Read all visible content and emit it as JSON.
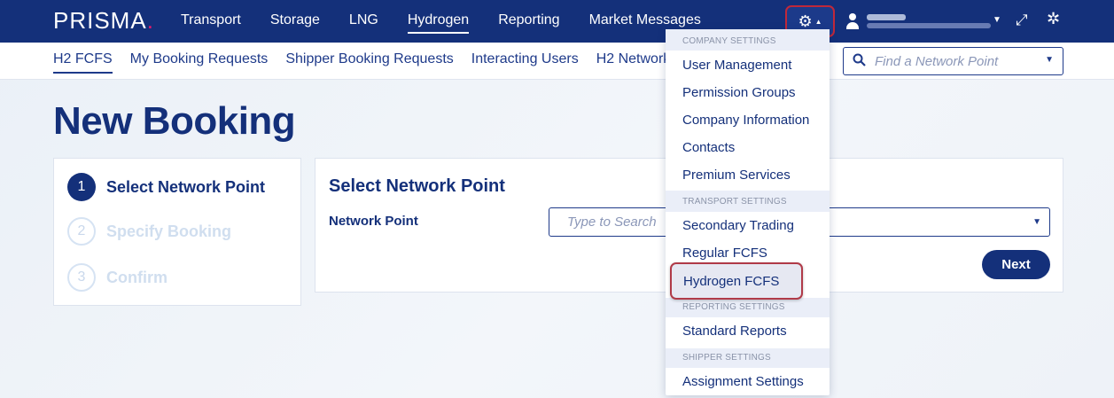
{
  "brand": {
    "name": "PRISMA",
    "dot": ".",
    "accent": "#e6196a",
    "primary": "#14307a"
  },
  "main_nav": [
    {
      "label": "Transport",
      "active": false
    },
    {
      "label": "Storage",
      "active": false
    },
    {
      "label": "LNG",
      "active": false
    },
    {
      "label": "Hydrogen",
      "active": true
    },
    {
      "label": "Reporting",
      "active": false
    },
    {
      "label": "Market Messages",
      "active": false
    }
  ],
  "header_icons": {
    "settings": "gear-icon",
    "user": "user-icon",
    "expand": "expand-icon",
    "bug": "bug-icon"
  },
  "sub_nav": [
    {
      "label": "H2 FCFS",
      "active": true
    },
    {
      "label": "My Booking Requests",
      "active": false
    },
    {
      "label": "Shipper Booking Requests",
      "active": false
    },
    {
      "label": "Interacting Users",
      "active": false
    },
    {
      "label": "H2 Network",
      "active": false
    }
  ],
  "network_search": {
    "placeholder": "Find a Network Point"
  },
  "page": {
    "title": "New Booking"
  },
  "steps": [
    {
      "num": "1",
      "label": "Select Network Point",
      "state": "active"
    },
    {
      "num": "2",
      "label": "Specify Booking",
      "state": "inactive"
    },
    {
      "num": "3",
      "label": "Confirm",
      "state": "inactive"
    }
  ],
  "form": {
    "title": "Select Network Point",
    "field_label": "Network Point",
    "placeholder": "Type to Search",
    "next_label": "Next"
  },
  "settings_menu": {
    "sections": [
      {
        "title": "COMPANY SETTINGS",
        "items": [
          "User Management",
          "Permission Groups",
          "Company Information",
          "Contacts",
          "Premium Services"
        ]
      },
      {
        "title": "TRANSPORT SETTINGS",
        "items": [
          "Secondary Trading",
          "Regular FCFS",
          "Hydrogen FCFS"
        ]
      },
      {
        "title": "REPORTING SETTINGS",
        "items": [
          "Standard Reports"
        ]
      },
      {
        "title": "SHIPPER SETTINGS",
        "items": [
          "Assignment Settings"
        ]
      }
    ],
    "highlighted": "Hydrogen FCFS"
  }
}
